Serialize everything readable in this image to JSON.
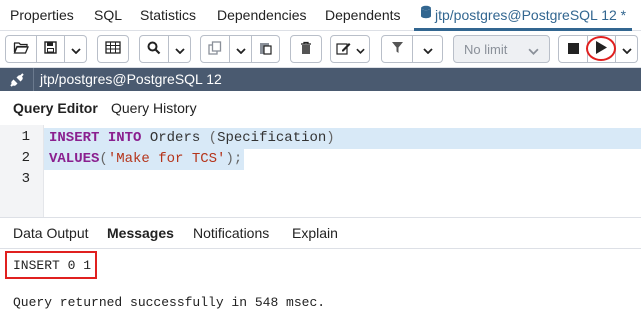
{
  "tabs": [
    {
      "label": "Properties"
    },
    {
      "label": "SQL"
    },
    {
      "label": "Statistics"
    },
    {
      "label": "Dependencies"
    },
    {
      "label": "Dependents"
    },
    {
      "label": "jtp/postgres@PostgreSQL 12 *",
      "active": true
    }
  ],
  "toolbar": {
    "open_icon": "folder-open-icon",
    "save_icon": "save-icon",
    "limit_value": "No limit",
    "accent_color": "#326690",
    "highlight_color": "#e0201f"
  },
  "connection": {
    "label": "jtp/postgres@PostgreSQL 12",
    "bar_color": "#4a5a70"
  },
  "editor_tabs": [
    {
      "label": "Query Editor",
      "active": true
    },
    {
      "label": "Query History"
    }
  ],
  "editor": {
    "line_numbers": [
      "1",
      "2",
      "3"
    ],
    "lines": [
      {
        "kw1": "INSERT",
        "kw2": "INTO",
        "rest": "Orders",
        "open": "(",
        "arg": "Specification",
        "close": ")"
      },
      {
        "kw1": "VALUES",
        "open": "(",
        "str": "'Make for TCS'",
        "close": ");"
      }
    ]
  },
  "result_tabs": [
    {
      "label": "Data Output"
    },
    {
      "label": "Messages",
      "active": true
    },
    {
      "label": "Notifications"
    },
    {
      "label": "Explain"
    }
  ],
  "messages": {
    "result": "INSERT 0 1",
    "status": "Query returned successfully in 548 msec."
  }
}
